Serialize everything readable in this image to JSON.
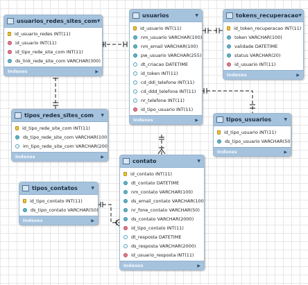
{
  "indexes_label": "Indexes",
  "tables": [
    {
      "id": "usuarios_redes_sites_com",
      "title": "usuarios_redes_sites_com",
      "columns": [
        {
          "name": "id_usuario_redes INT(11)",
          "kind": "pk"
        },
        {
          "name": "id_usuario INT(11)",
          "kind": "fk"
        },
        {
          "name": "id_tipo_rede_site_com INT(11)",
          "kind": "fk"
        },
        {
          "name": "ds_link_rede_site_com VARCHAR(300)",
          "kind": "nn"
        }
      ]
    },
    {
      "id": "usuarios",
      "title": "usuarios",
      "columns": [
        {
          "name": "id_usuario INT(11)",
          "kind": "pk"
        },
        {
          "name": "nm_usuario VARCHAR(100)",
          "kind": "nn"
        },
        {
          "name": "nm_email VARCHAR(100)",
          "kind": "nn"
        },
        {
          "name": "pw_usuario VARCHAR(255)",
          "kind": "nn"
        },
        {
          "name": "dt_criacao DATETIME",
          "kind": "col"
        },
        {
          "name": "id_token INT(11)",
          "kind": "col"
        },
        {
          "name": "cd_ddi_telefone INT(11)",
          "kind": "col"
        },
        {
          "name": "cd_ddd_telefone INT(11)",
          "kind": "col"
        },
        {
          "name": "nr_telefone INT(11)",
          "kind": "col"
        },
        {
          "name": "id_tipo_usuario INT(11)",
          "kind": "fk"
        }
      ]
    },
    {
      "id": "tokens_recuperacao",
      "title": "tokens_recuperacao",
      "columns": [
        {
          "name": "id_token_recuperacao INT(11)",
          "kind": "pk"
        },
        {
          "name": "token VARCHAR(100)",
          "kind": "nn"
        },
        {
          "name": "validade DATETIME",
          "kind": "nn"
        },
        {
          "name": "status VARCHAR(20)",
          "kind": "nn"
        },
        {
          "name": "id_usuario INT(11)",
          "kind": "fk"
        }
      ]
    },
    {
      "id": "tipos_redes_sites_com",
      "title": "tipos_redes_sites_com",
      "columns": [
        {
          "name": "id_tipo_rede_site_com INT(11)",
          "kind": "pk"
        },
        {
          "name": "ds_tipo_rede_site_com VARCHAR(100)",
          "kind": "nn"
        },
        {
          "name": "im_tipo_rede_site_com VARCHAR(200)",
          "kind": "col"
        }
      ]
    },
    {
      "id": "tipos_usuarios",
      "title": "tipos_usuarios",
      "columns": [
        {
          "name": "id_tipo_usuario INT(11)",
          "kind": "pk"
        },
        {
          "name": "ds_tipo_usuario VARCHAR(50)",
          "kind": "nn"
        }
      ]
    },
    {
      "id": "contato",
      "title": "contato",
      "columns": [
        {
          "name": "id_contato INT(11)",
          "kind": "pk"
        },
        {
          "name": "dt_contato DATETIME",
          "kind": "nn"
        },
        {
          "name": "nm_contato VARCHAR(100)",
          "kind": "nn"
        },
        {
          "name": "ds_email_contato VARCHAR(100)",
          "kind": "nn"
        },
        {
          "name": "nr_fone_contato VARCHAR(50)",
          "kind": "nn"
        },
        {
          "name": "ds_contato VARCHAR(2000)",
          "kind": "nn"
        },
        {
          "name": "id_tipo_contato INT(11)",
          "kind": "fk"
        },
        {
          "name": "dt_resposta DATETIME",
          "kind": "col"
        },
        {
          "name": "ds_resposta VARCHAR(2000)",
          "kind": "col"
        },
        {
          "name": "id_usuario_resposta INT(11)",
          "kind": "fk"
        }
      ]
    },
    {
      "id": "tipos_contatos",
      "title": "tipos_contatos",
      "columns": [
        {
          "name": "id_tipo_contato INT(11)",
          "kind": "pk"
        },
        {
          "name": "ds_tipo_contato VARCHAR(50)",
          "kind": "nn"
        }
      ]
    }
  ],
  "relationships": [
    {
      "from": "usuarios_redes_sites_com",
      "to": "usuarios"
    },
    {
      "from": "usuarios_redes_sites_com",
      "to": "tipos_redes_sites_com"
    },
    {
      "from": "tokens_recuperacao",
      "to": "usuarios"
    },
    {
      "from": "usuarios",
      "to": "tipos_usuarios"
    },
    {
      "from": "contato",
      "to": "usuarios"
    },
    {
      "from": "contato",
      "to": "tipos_contatos"
    }
  ]
}
